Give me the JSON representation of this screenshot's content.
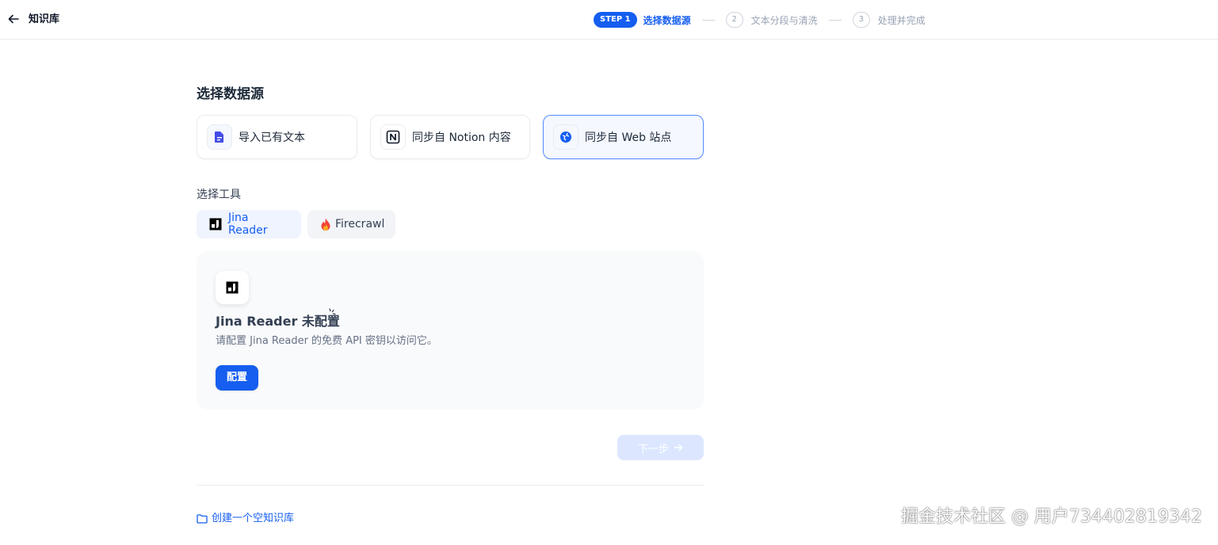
{
  "header": {
    "title": "知识库",
    "back_icon": "arrow-left-icon"
  },
  "steps": [
    {
      "badge": "STEP 1",
      "label": "选择数据源",
      "active": true
    },
    {
      "badge": "2",
      "label": "文本分段与清洗",
      "active": false
    },
    {
      "badge": "3",
      "label": "处理并完成",
      "active": false
    }
  ],
  "main": {
    "title": "选择数据源",
    "sources": [
      {
        "label": "导入已有文本",
        "icon": "document-icon"
      },
      {
        "label": "同步自 Notion 内容",
        "icon": "notion-icon"
      },
      {
        "label": "同步自 Web 站点",
        "icon": "globe-icon",
        "selected": true
      }
    ],
    "tools_label": "选择工具",
    "tools": [
      {
        "label": "Jina Reader",
        "icon": "jina-icon",
        "selected": true
      },
      {
        "label": "Firecrawl",
        "icon": "fire-icon"
      }
    ],
    "panel": {
      "title": "Jina Reader 未配置",
      "description": "请配置 Jina Reader 的免费 API 密钥以访问它。",
      "button": "配置"
    },
    "next_button": "下一步",
    "create_empty": "创建一个空知识库"
  },
  "watermark": "掘金技术社区 @ 用户734402819342",
  "colors": {
    "accent": "#155eef",
    "panel_bg": "#f9fafb",
    "border": "#eaecf0"
  }
}
